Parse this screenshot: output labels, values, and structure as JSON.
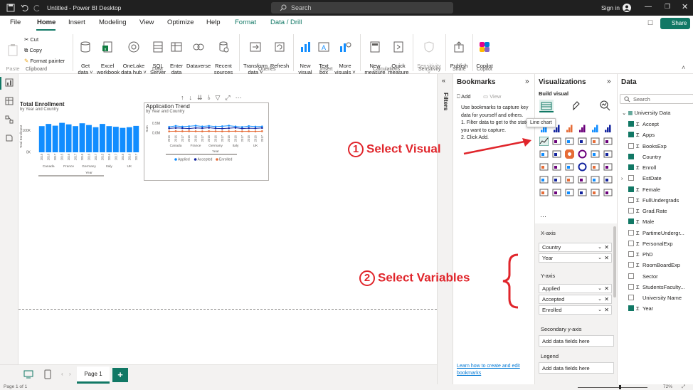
{
  "titlebar": {
    "title": "Untitled - Power BI Desktop",
    "search_placeholder": "Search",
    "sign_in": "Sign in",
    "share": "Share"
  },
  "tabs": [
    "File",
    "Home",
    "Insert",
    "Modeling",
    "View",
    "Optimize",
    "Help",
    "Format",
    "Data / Drill"
  ],
  "ribbon": {
    "clipboard": {
      "paste": "Paste",
      "cut": "Cut",
      "copy": "Copy",
      "format_painter": "Format painter",
      "group": "Clipboard"
    },
    "data": {
      "get_data": "Get\ndata ˅",
      "excel": "Excel\nworkbook",
      "onelake": "OneLake\ndata hub ˅",
      "sql": "SQL\nServer",
      "enter": "Enter\ndata",
      "dataverse": "Dataverse",
      "recent": "Recent\nsources ˅",
      "group": "Data"
    },
    "queries": {
      "transform": "Transform\ndata ˅",
      "refresh": "Refresh",
      "group": "Queries"
    },
    "insert": {
      "new_visual": "New\nvisual",
      "text_box": "Text\nbox",
      "more_visuals": "More\nvisuals ˅",
      "group": "Insert"
    },
    "calculations": {
      "new_measure": "New\nmeasure",
      "quick_measure": "Quick\nmeasure",
      "group": "Calculations"
    },
    "sensitivity": {
      "label": "Sensitivity\n˅",
      "group": "Sensitivity"
    },
    "share": {
      "publish": "Publish",
      "group": "Share"
    },
    "copilot": {
      "label": "Copilot",
      "group": "Copilot"
    }
  },
  "canvas": {
    "chart1": {
      "title": "Total Enrollment",
      "subtitle": "by Year and Country",
      "ylabel": "Total Enrollment",
      "xlabel": "Year",
      "yticks": [
        "100K",
        "0K"
      ],
      "countries": [
        "Canada",
        "France",
        "Germany",
        "Italy",
        "UK"
      ],
      "years": [
        "2015",
        "2016",
        "2017"
      ]
    },
    "chart2": {
      "title": "Application Trend",
      "subtitle": "by Year and Country",
      "ylabel": "Sum",
      "xlabel": "Year",
      "yticks": [
        "0.5M",
        "0.0M"
      ],
      "countries": [
        "Canada",
        "France",
        "Germany",
        "Italy",
        "UK"
      ],
      "years": [
        "2015",
        "2016",
        "2017"
      ],
      "legend": [
        "Applied",
        "Accepted",
        "Enrolled"
      ]
    }
  },
  "chart_data": [
    {
      "type": "bar",
      "title": "Total Enrollment",
      "subtitle": "by Year and Country",
      "ylabel": "Total Enrollment",
      "xlabel": "Year",
      "categories": [
        "2015",
        "2016",
        "2017",
        "2015",
        "2016",
        "2017",
        "2015",
        "2016",
        "2017",
        "2015",
        "2016",
        "2017",
        "2015",
        "2016",
        "2017"
      ],
      "groups": [
        "Canada",
        "France",
        "Germany",
        "Italy",
        "UK"
      ],
      "values": [
        120000,
        130000,
        122000,
        135000,
        128000,
        120000,
        133000,
        125000,
        115000,
        130000,
        120000,
        117000,
        112000,
        115000,
        121000
      ],
      "ylim": [
        0,
        150000
      ],
      "color": "#118dff"
    },
    {
      "type": "line",
      "title": "Application Trend",
      "subtitle": "by Year and Country",
      "ylabel": "Sum",
      "xlabel": "Year",
      "categories": [
        "2015",
        "2016",
        "2017",
        "2015",
        "2016",
        "2017",
        "2015",
        "2016",
        "2017",
        "2015",
        "2016",
        "2017",
        "2015",
        "2016",
        "2017"
      ],
      "groups": [
        "Canada",
        "France",
        "Germany",
        "Italy",
        "UK"
      ],
      "series": [
        {
          "name": "Applied",
          "color": "#118dff",
          "values": [
            330000,
            380000,
            340000,
            360000,
            390000,
            350000,
            380000,
            340000,
            360000,
            390000,
            350000,
            320000,
            370000,
            340000,
            350000
          ]
        },
        {
          "name": "Accepted",
          "color": "#12239e",
          "values": [
            250000,
            270000,
            260000,
            240000,
            270000,
            260000,
            280000,
            250000,
            240000,
            260000,
            280000,
            240000,
            260000,
            250000,
            270000
          ]
        },
        {
          "name": "Enrolled",
          "color": "#e66c37",
          "values": [
            90000,
            100000,
            95000,
            100000,
            95000,
            90000,
            100000,
            95000,
            90000,
            95000,
            100000,
            90000,
            95000,
            90000,
            100000
          ]
        }
      ],
      "ylim": [
        0,
        600000
      ]
    }
  ],
  "filters": {
    "label": "Filters"
  },
  "bookmarks": {
    "title": "Bookmarks",
    "add": "Add",
    "view": "View",
    "help": "Use bookmarks to capture key data for yourself and others.\n1. Filter data to get to the state you want to capture.\n2. Click Add.",
    "link": "Learn how to create and edit bookmarks"
  },
  "visualizations": {
    "title": "Visualizations",
    "build": "Build visual",
    "tooltip": "Line chart",
    "xaxis": "X-axis",
    "xfields": [
      "Country",
      "Year"
    ],
    "yaxis": "Y-axis",
    "yfields": [
      "Applied",
      "Accepted",
      "Enrolled"
    ],
    "secondary": "Secondary y-axis",
    "add_fields": "Add data fields here",
    "legend": "Legend",
    "add_fields2": "Add data fields here"
  },
  "data_pane": {
    "title": "Data",
    "search_placeholder": "Search",
    "table": "University Data",
    "fields": [
      {
        "name": "Accept",
        "sigma": true,
        "checked": true
      },
      {
        "name": "Apps",
        "sigma": true,
        "checked": true
      },
      {
        "name": "BooksExp",
        "sigma": true,
        "checked": false
      },
      {
        "name": "Country",
        "sigma": false,
        "checked": true
      },
      {
        "name": "Enroll",
        "sigma": true,
        "checked": true
      },
      {
        "name": "EstDate",
        "sigma": false,
        "checked": false,
        "expand": true
      },
      {
        "name": "Female",
        "sigma": true,
        "checked": true
      },
      {
        "name": "FullUndergrads",
        "sigma": true,
        "checked": false
      },
      {
        "name": "Grad.Rate",
        "sigma": true,
        "checked": false
      },
      {
        "name": "Male",
        "sigma": true,
        "checked": true
      },
      {
        "name": "PartimeUndergr...",
        "sigma": true,
        "checked": false
      },
      {
        "name": "PersonalExp",
        "sigma": true,
        "checked": false
      },
      {
        "name": "PhD",
        "sigma": true,
        "checked": false
      },
      {
        "name": "RoomBoardExp",
        "sigma": true,
        "checked": false
      },
      {
        "name": "Sector",
        "sigma": false,
        "checked": false
      },
      {
        "name": "StudentsFaculty...",
        "sigma": true,
        "checked": false
      },
      {
        "name": "University Name",
        "sigma": false,
        "checked": false
      },
      {
        "name": "Year",
        "sigma": true,
        "checked": true
      }
    ]
  },
  "annotations": {
    "step1_num": "1",
    "step1": "Select Visual",
    "step2_num": "2",
    "step2": "Select Variables"
  },
  "pagebar": {
    "page": "Page 1",
    "add": "+"
  },
  "statusbar": {
    "left": "Page 1 of 1",
    "zoom": "72%"
  },
  "colors": {
    "accent": "#117865",
    "bar": "#118dff",
    "annotation": "#e0252b"
  }
}
